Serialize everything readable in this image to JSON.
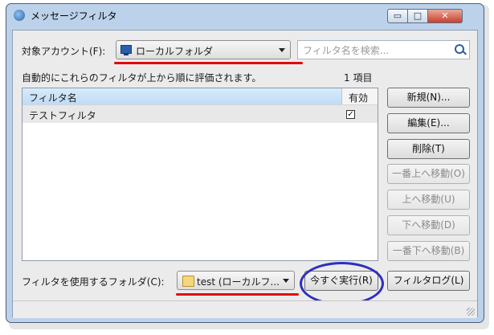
{
  "window": {
    "title": "メッセージフィルタ",
    "min_glyph": "▭",
    "max_glyph": "□",
    "close_glyph": "✕"
  },
  "account": {
    "label": "対象アカウント(F):",
    "value": "ローカルフォルダ"
  },
  "search": {
    "placeholder": "フィルタ名を検索..."
  },
  "info": {
    "description": "自動的にこれらのフィルタが上から順に評価されます。",
    "count": "1 項目"
  },
  "filter_list": {
    "columns": [
      "フィルタ名",
      "有効"
    ],
    "rows": [
      {
        "name": "テストフィルタ",
        "enabled": true
      }
    ]
  },
  "buttons": {
    "new": "新規(N)...",
    "edit": "編集(E)...",
    "delete": "削除(T)",
    "move_top": "一番上へ移動(O)",
    "move_up": "上へ移動(U)",
    "move_down": "下へ移動(D)",
    "move_bottom": "一番下へ移動(B)",
    "run_now": "今すぐ実行(R)",
    "filter_log": "フィルタログ(L)"
  },
  "folder": {
    "label": "フィルタを使用するフォルダ(C):",
    "value": "test (ローカルフ..."
  },
  "colors": {
    "annotation_underline": "#e10a0a",
    "annotation_circle": "#2d2fbf"
  }
}
